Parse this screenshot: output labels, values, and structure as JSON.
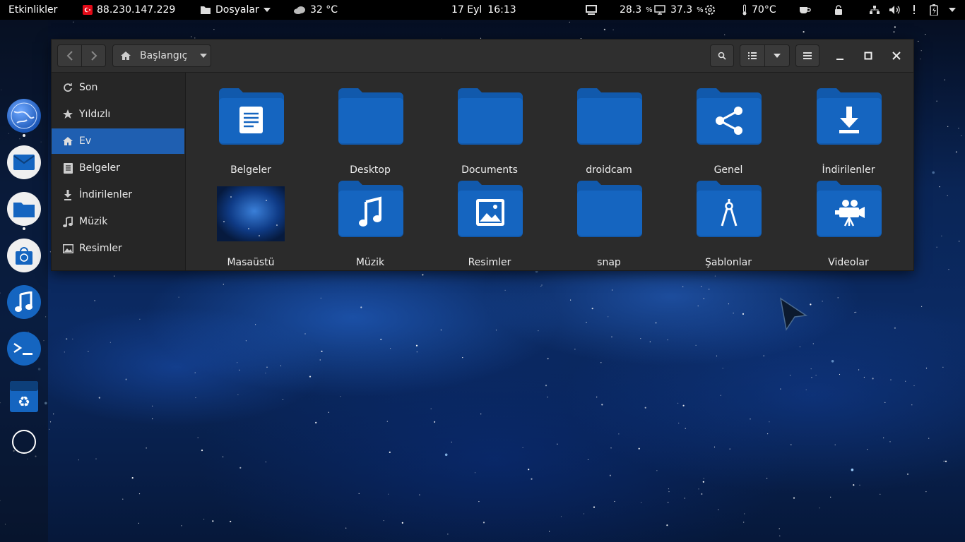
{
  "topbar": {
    "activities": "Etkinlikler",
    "ip": "88.230.147.229",
    "app_menu": "Dosyalar",
    "weather": "32 °C",
    "date": "17 Eyl",
    "time": "16:13",
    "cpu_pct": "28.3",
    "mem_pct": "37.3",
    "pct_unit": "%",
    "temp": "70°C"
  },
  "dock": {
    "items": [
      "browser-icon",
      "mail-icon",
      "files-icon",
      "software-store-icon",
      "music-icon",
      "terminal-icon",
      "trash-icon",
      "show-apps-icon"
    ]
  },
  "window": {
    "location": "Başlangıç",
    "sidebar": [
      {
        "label": "Son",
        "icon": "recent-icon"
      },
      {
        "label": "Yıldızlı",
        "icon": "star-icon"
      },
      {
        "label": "Ev",
        "icon": "home-icon",
        "active": true
      },
      {
        "label": "Belgeler",
        "icon": "document-icon"
      },
      {
        "label": "İndirilenler",
        "icon": "download-icon"
      },
      {
        "label": "Müzik",
        "icon": "music-note-icon"
      },
      {
        "label": "Resimler",
        "icon": "image-icon"
      }
    ],
    "files": [
      {
        "label": "Belgeler",
        "emblem": "document"
      },
      {
        "label": "Desktop",
        "emblem": "none"
      },
      {
        "label": "Documents",
        "emblem": "none"
      },
      {
        "label": "droidcam",
        "emblem": "none"
      },
      {
        "label": "Genel",
        "emblem": "share"
      },
      {
        "label": "İndirilenler",
        "emblem": "download"
      },
      {
        "label": "Masaüstü",
        "emblem": "thumbnail"
      },
      {
        "label": "Müzik",
        "emblem": "music"
      },
      {
        "label": "Resimler",
        "emblem": "image"
      },
      {
        "label": "snap",
        "emblem": "none"
      },
      {
        "label": "Şablonlar",
        "emblem": "template"
      },
      {
        "label": "Videolar",
        "emblem": "video"
      }
    ]
  },
  "colors": {
    "folder": "#1565c0",
    "folder_tab": "#1159ac",
    "accent": "#1f5fb1"
  }
}
